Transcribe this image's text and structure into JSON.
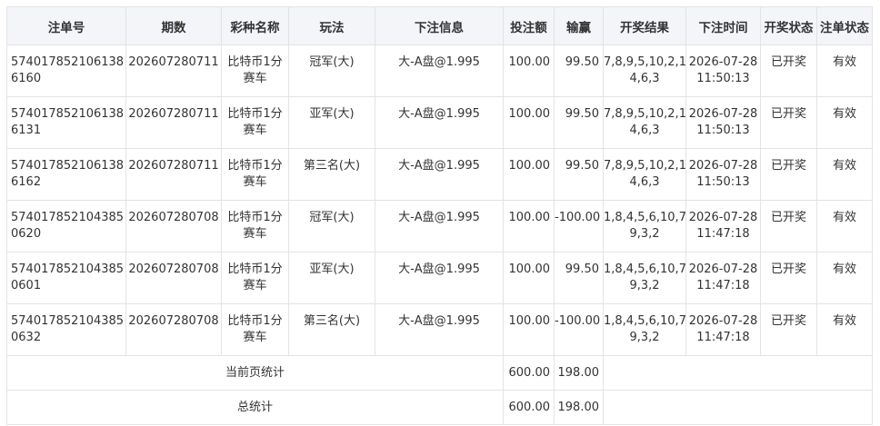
{
  "headers": [
    "注单号",
    "期数",
    "彩种名称",
    "玩法",
    "下注信息",
    "投注额",
    "输赢",
    "开奖结果",
    "下注时间",
    "开奖状态",
    "注单状态"
  ],
  "rows": [
    {
      "order_line1": "574017852106138",
      "order_line2": "6160",
      "period": "202607280711",
      "lottery_line1": "比特币1分",
      "lottery_line2": "赛车",
      "play": "冠军(大)",
      "info": "大-A盘@1.995",
      "amount": "100.00",
      "winloss": "99.50",
      "result_line1": "7,8,9,5,10,2,1,",
      "result_line2": "4,6,3",
      "time_line1": "2026-07-28",
      "time_line2": "11:50:13",
      "draw_status": "已开奖",
      "order_status": "有效"
    },
    {
      "order_line1": "574017852106138",
      "order_line2": "6131",
      "period": "202607280711",
      "lottery_line1": "比特币1分",
      "lottery_line2": "赛车",
      "play": "亚军(大)",
      "info": "大-A盘@1.995",
      "amount": "100.00",
      "winloss": "99.50",
      "result_line1": "7,8,9,5,10,2,1,",
      "result_line2": "4,6,3",
      "time_line1": "2026-07-28",
      "time_line2": "11:50:13",
      "draw_status": "已开奖",
      "order_status": "有效"
    },
    {
      "order_line1": "574017852106138",
      "order_line2": "6162",
      "period": "202607280711",
      "lottery_line1": "比特币1分",
      "lottery_line2": "赛车",
      "play": "第三名(大)",
      "info": "大-A盘@1.995",
      "amount": "100.00",
      "winloss": "99.50",
      "result_line1": "7,8,9,5,10,2,1,",
      "result_line2": "4,6,3",
      "time_line1": "2026-07-28",
      "time_line2": "11:50:13",
      "draw_status": "已开奖",
      "order_status": "有效"
    },
    {
      "order_line1": "574017852104385",
      "order_line2": "0620",
      "period": "202607280708",
      "lottery_line1": "比特币1分",
      "lottery_line2": "赛车",
      "play": "冠军(大)",
      "info": "大-A盘@1.995",
      "amount": "100.00",
      "winloss": "-100.00",
      "result_line1": "1,8,4,5,6,10,7,",
      "result_line2": "9,3,2",
      "time_line1": "2026-07-28",
      "time_line2": "11:47:18",
      "draw_status": "已开奖",
      "order_status": "有效"
    },
    {
      "order_line1": "574017852104385",
      "order_line2": "0601",
      "period": "202607280708",
      "lottery_line1": "比特币1分",
      "lottery_line2": "赛车",
      "play": "亚军(大)",
      "info": "大-A盘@1.995",
      "amount": "100.00",
      "winloss": "99.50",
      "result_line1": "1,8,4,5,6,10,7,",
      "result_line2": "9,3,2",
      "time_line1": "2026-07-28",
      "time_line2": "11:47:18",
      "draw_status": "已开奖",
      "order_status": "有效"
    },
    {
      "order_line1": "574017852104385",
      "order_line2": "0632",
      "period": "202607280708",
      "lottery_line1": "比特币1分",
      "lottery_line2": "赛车",
      "play": "第三名(大)",
      "info": "大-A盘@1.995",
      "amount": "100.00",
      "winloss": "-100.00",
      "result_line1": "1,8,4,5,6,10,7,",
      "result_line2": "9,3,2",
      "time_line1": "2026-07-28",
      "time_line2": "11:47:18",
      "draw_status": "已开奖",
      "order_status": "有效"
    }
  ],
  "summary": {
    "page_label": "当前页统计",
    "page_amount": "600.00",
    "page_winloss": "198.00",
    "total_label": "总统计",
    "total_amount": "600.00",
    "total_winloss": "198.00"
  }
}
